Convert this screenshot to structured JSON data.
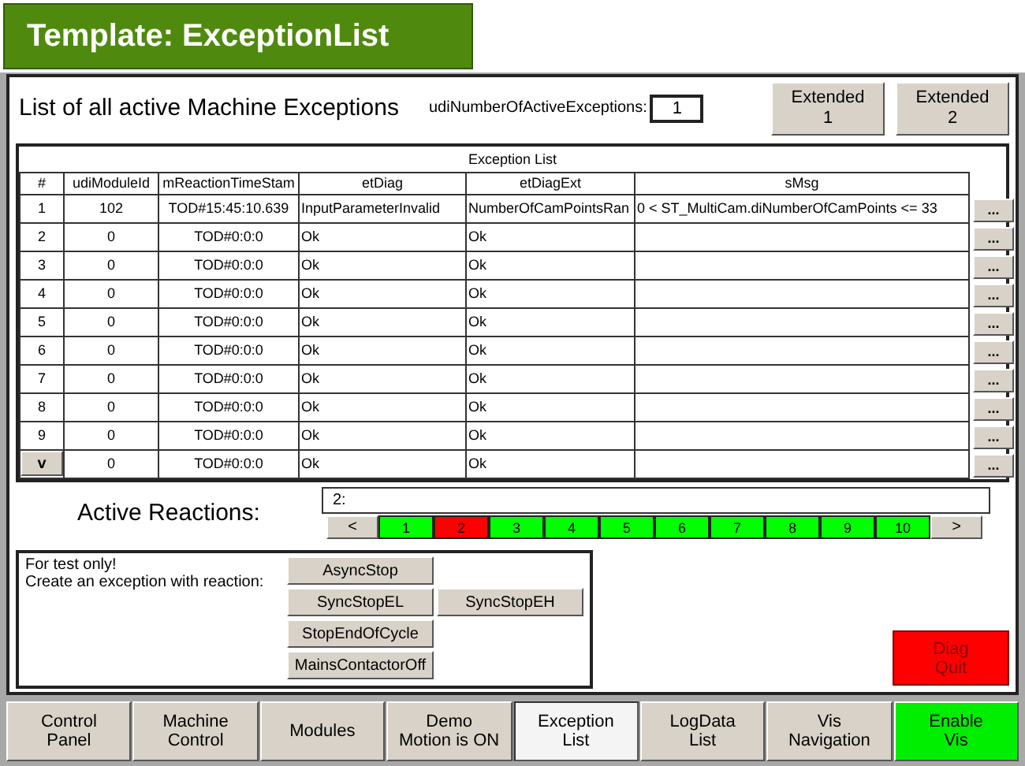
{
  "header": {
    "title": "Template: ExceptionList"
  },
  "heading": "List of all active Machine Exceptions",
  "active_count": {
    "label": "udiNumberOfActiveExceptions:",
    "value": "1"
  },
  "extended_buttons": [
    "Extended\n1",
    "Extended\n2"
  ],
  "table": {
    "title": "Exception List",
    "columns": [
      "#",
      "udiModuleId",
      "mReactionTimeStam",
      "etDiag",
      "etDiagExt",
      "sMsg"
    ],
    "rows": [
      {
        "kind": "text",
        "index": "1",
        "module_id": "102",
        "timestamp": "TOD#15:45:10.639",
        "et_diag": "InputParameterInvalid",
        "et_diag_ext": "NumberOfCamPointsRan",
        "message": "0 < ST_MultiCam.diNumberOfCamPoints <= 33",
        "details": "..."
      },
      {
        "kind": "text",
        "index": "2",
        "module_id": "0",
        "timestamp": "TOD#0:0:0",
        "et_diag": "Ok",
        "et_diag_ext": "Ok",
        "details": "..."
      },
      {
        "kind": "text",
        "index": "3",
        "module_id": "0",
        "timestamp": "TOD#0:0:0",
        "et_diag": "Ok",
        "et_diag_ext": "Ok",
        "details": "..."
      },
      {
        "kind": "text",
        "index": "4",
        "module_id": "0",
        "timestamp": "TOD#0:0:0",
        "et_diag": "Ok",
        "et_diag_ext": "Ok",
        "details": "..."
      },
      {
        "kind": "text",
        "index": "5",
        "module_id": "0",
        "timestamp": "TOD#0:0:0",
        "et_diag": "Ok",
        "et_diag_ext": "Ok",
        "details": "..."
      },
      {
        "kind": "text",
        "index": "6",
        "module_id": "0",
        "timestamp": "TOD#0:0:0",
        "et_diag": "Ok",
        "et_diag_ext": "Ok",
        "details": "..."
      },
      {
        "kind": "text",
        "index": "7",
        "module_id": "0",
        "timestamp": "TOD#0:0:0",
        "et_diag": "Ok",
        "et_diag_ext": "Ok",
        "details": "..."
      },
      {
        "kind": "text",
        "index": "8",
        "module_id": "0",
        "timestamp": "TOD#0:0:0",
        "et_diag": "Ok",
        "et_diag_ext": "Ok",
        "details": "..."
      },
      {
        "kind": "text",
        "index": "9",
        "module_id": "0",
        "timestamp": "TOD#0:0:0",
        "et_diag": "Ok",
        "et_diag_ext": "Ok",
        "details": "..."
      },
      {
        "kind": "button",
        "index": "v",
        "module_id": "0",
        "timestamp": "TOD#0:0:0",
        "et_diag": "Ok",
        "et_diag_ext": "Ok",
        "details": "..."
      }
    ]
  },
  "active_reactions": {
    "label": "Active Reactions:",
    "value": "2:",
    "prev": "<",
    "next": ">",
    "pages": [
      {
        "label": "1",
        "color": "#00ff00"
      },
      {
        "label": "2",
        "color": "#ff0000"
      },
      {
        "label": "3",
        "color": "#00ff00"
      },
      {
        "label": "4",
        "color": "#00ff00"
      },
      {
        "label": "5",
        "color": "#00ff00"
      },
      {
        "label": "6",
        "color": "#00ff00"
      },
      {
        "label": "7",
        "color": "#00ff00"
      },
      {
        "label": "8",
        "color": "#00ff00"
      },
      {
        "label": "9",
        "color": "#00ff00"
      },
      {
        "label": "10",
        "color": "#00ff00"
      }
    ]
  },
  "test_panel": {
    "note": "For test only!\nCreate an exception with reaction:",
    "buttons": [
      [
        "AsyncStop"
      ],
      [
        "SyncStopEL",
        "SyncStopEH"
      ],
      [
        "StopEndOfCycle"
      ],
      [
        "MainsContactorOff"
      ]
    ]
  },
  "diag_quit": "Diag\nQuit",
  "nav": [
    {
      "label": "Control\nPanel",
      "selected": false,
      "kind": "normal"
    },
    {
      "label": "Machine\nControl",
      "selected": false,
      "kind": "normal"
    },
    {
      "label": "Modules",
      "selected": false,
      "kind": "normal"
    },
    {
      "label": "Demo\nMotion is ON",
      "selected": false,
      "kind": "normal"
    },
    {
      "label": "Exception\nList",
      "selected": true,
      "kind": "normal"
    },
    {
      "label": "LogData\nList",
      "selected": false,
      "kind": "normal"
    },
    {
      "label": "Vis\nNavigation",
      "selected": false,
      "kind": "normal"
    },
    {
      "label": "Enable\nVis",
      "selected": false,
      "kind": "green"
    }
  ]
}
